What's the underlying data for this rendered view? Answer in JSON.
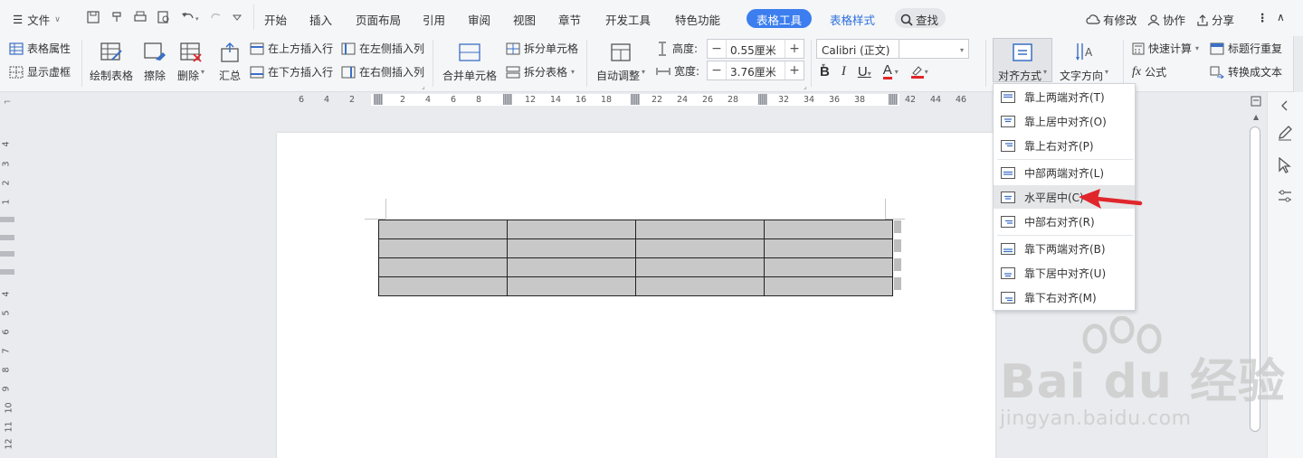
{
  "menubar": {
    "file_label": "文件",
    "tabs": [
      "开始",
      "插入",
      "页面布局",
      "引用",
      "审阅",
      "视图",
      "章节",
      "开发工具",
      "特色功能"
    ],
    "active_tab": "表格工具",
    "style_tab": "表格样式",
    "search_label": "查找",
    "has_changes": "有修改",
    "collab": "协作",
    "share": "分享"
  },
  "ribbon": {
    "table_props": "表格属性",
    "show_grid": "显示虚框",
    "draw_table": "绘制表格",
    "erase": "擦除",
    "delete": "删除",
    "summary": "汇总",
    "insert_above": "在上方插入行",
    "insert_below": "在下方插入行",
    "insert_left": "在左侧插入列",
    "insert_right": "在右侧插入列",
    "merge_cells": "合并单元格",
    "split_cells": "拆分单元格",
    "split_table": "拆分表格",
    "auto_fit": "自动调整",
    "height_label": "高度:",
    "height_value": "0.55厘米",
    "width_label": "宽度:",
    "width_value": "3.76厘米",
    "font_name": "Calibri (正文)",
    "align_label": "对齐方式",
    "text_dir_label": "文字方向",
    "quick_calc": "快速计算",
    "repeat_header": "标题行重复",
    "formula": "公式",
    "convert_text": "转换成文本"
  },
  "ruler": {
    "h_ticks": [
      "6",
      "4",
      "2",
      "2",
      "4",
      "6",
      "8",
      "12",
      "14",
      "16",
      "18",
      "22",
      "24",
      "26",
      "28",
      "32",
      "34",
      "36",
      "38",
      "42",
      "44",
      "46"
    ],
    "v_ticks": [
      "4",
      "3",
      "2",
      "1",
      "4",
      "5",
      "6",
      "7",
      "8",
      "9",
      "10",
      "11",
      "12"
    ]
  },
  "dropdown": {
    "items": [
      "靠上两端对齐(T)",
      "靠上居中对齐(O)",
      "靠上右对齐(P)",
      "中部两端对齐(L)",
      "水平居中(C)",
      "中部右对齐(R)",
      "靠下两端对齐(B)",
      "靠下居中对齐(U)",
      "靠下右对齐(M)"
    ],
    "highlighted_index": 4
  },
  "table": {
    "rows": 4,
    "cols": 4
  },
  "watermark": {
    "brand": "Bai du 经验",
    "url": "jingyan.baidu.com"
  },
  "colors": {
    "accent": "#3c7eef",
    "arrow": "#e0262b",
    "font_color": "#e0262b"
  }
}
